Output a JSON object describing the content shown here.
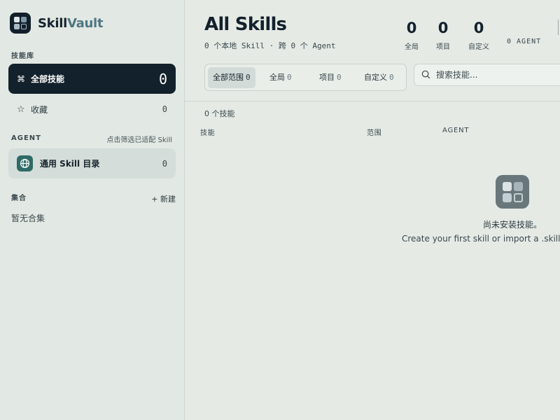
{
  "brand": {
    "name_part1": "Skill",
    "name_part2": "Vault"
  },
  "sidebar": {
    "library_label": "技能库",
    "all_skills": {
      "label": "全部技能",
      "count": "0",
      "icon": "command-icon"
    },
    "favorites": {
      "label": "收藏",
      "count": "0",
      "icon": "star-icon"
    },
    "agent_label": "AGENT",
    "agent_hint": "点击筛选已适配 Skill",
    "agent_item": {
      "label": "通用 Skill 目录",
      "count": "0",
      "icon": "globe-icon"
    },
    "collections_label": "集合",
    "new_collection": "+ 新建",
    "no_collections": "暂无合集"
  },
  "main": {
    "title": "All Skills",
    "subtitle": "0 个本地 Skill · 跨 0 个 Agent",
    "stats": [
      {
        "value": "0",
        "label": "全局"
      },
      {
        "value": "0",
        "label": "项目"
      },
      {
        "value": "0",
        "label": "自定义"
      }
    ],
    "agent_stat": "0 AGENT",
    "scope_tabs": [
      {
        "label": "全部范围",
        "count": "0",
        "active": true
      },
      {
        "label": "全局",
        "count": "0",
        "active": false
      },
      {
        "label": "项目",
        "count": "0",
        "active": false
      },
      {
        "label": "自定义",
        "count": "0",
        "active": false
      }
    ],
    "search_placeholder": "搜索技能...",
    "count_line": "0 个技能",
    "columns": [
      "技能",
      "范围",
      "AGENT"
    ],
    "empty_title": "尚未安装技能。",
    "empty_sub": "Create your first skill or import a .skill"
  }
}
